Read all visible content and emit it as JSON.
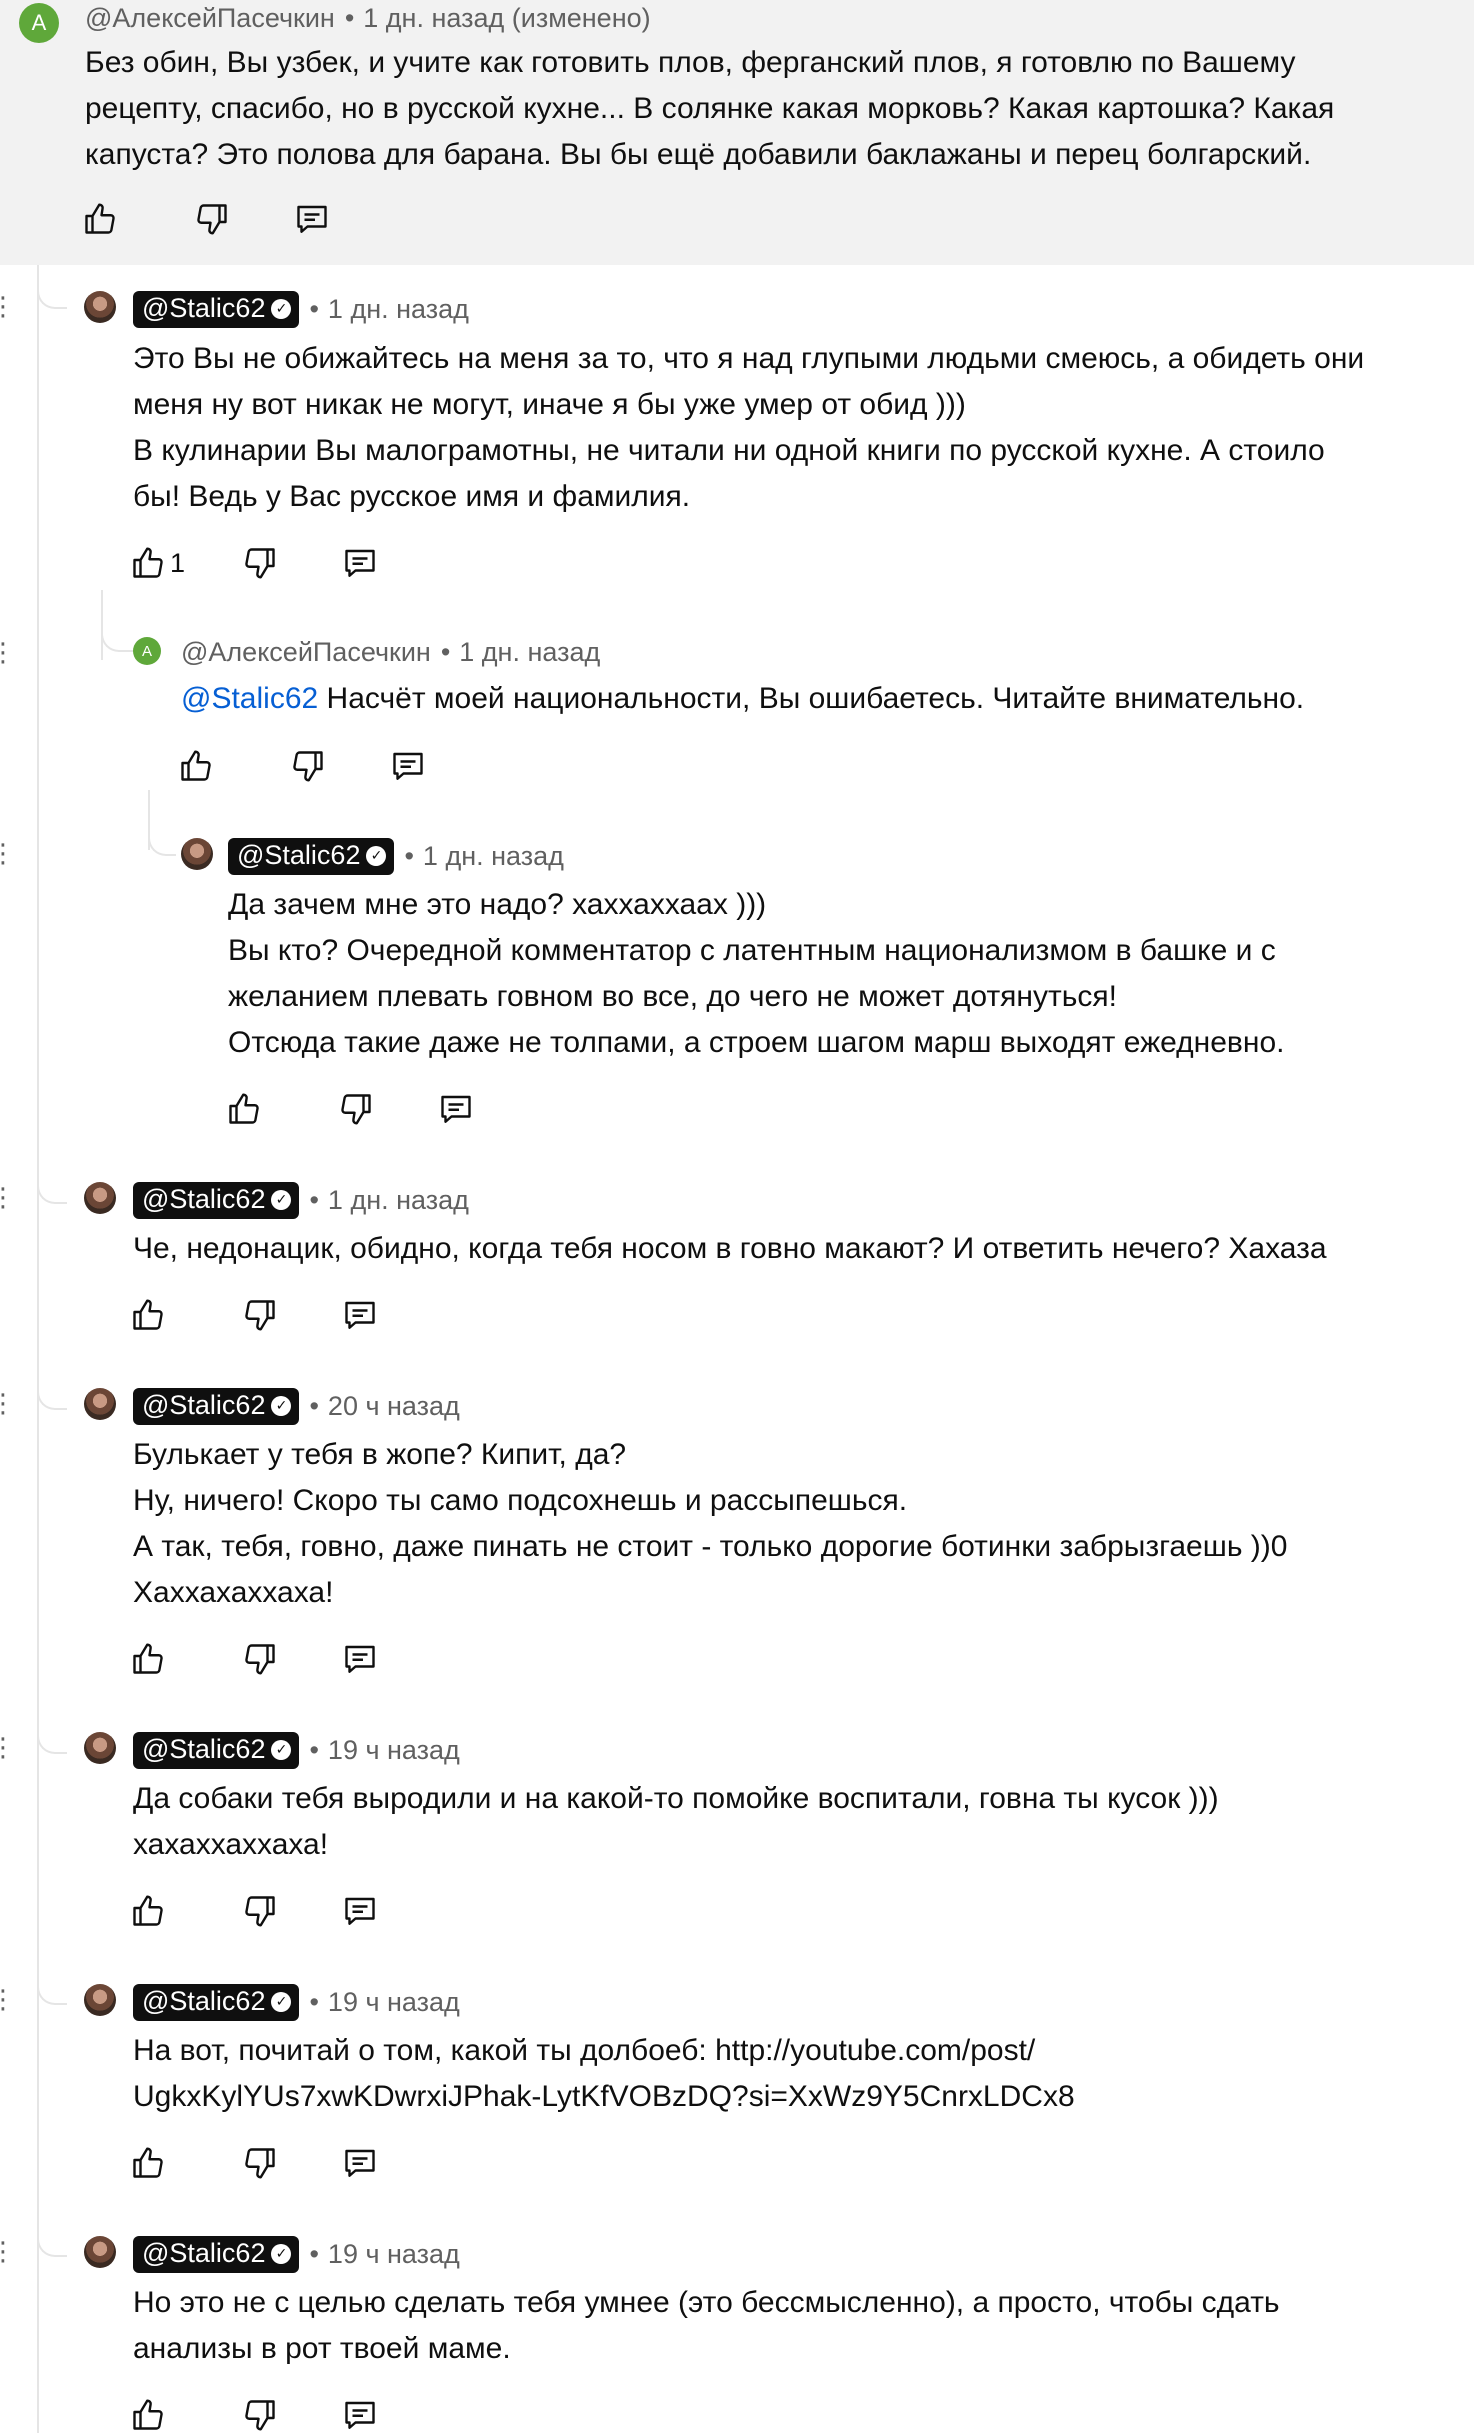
{
  "comments": [
    {
      "author": "@АлексейПасечкин",
      "avatar_letter": "А",
      "time": "1 дн. назад (изменено)",
      "lines": [
        "Без обин, Вы узбек, и учите как готовить плов, ферганский плов, я готовлю по Вашему",
        "рецепту, спасибо, но в русской кухне... В солянке  какая морковь? Какая картошка? Какая",
        "капуста? Это полова для барана. Вы бы ещё добавили баклажаны и перец болгарский."
      ],
      "likes": ""
    },
    {
      "author": "@Stalic62",
      "time": "1 дн. назад",
      "lines": [
        "Это Вы не обижайтесь на меня за то, что я над глупыми людьми смеюсь, а обидеть они",
        "меня ну вот никак не могут, иначе я бы уже умер от обид )))",
        "В кулинарии Вы малограмотны, не читали ни одной книги по русской кухне. А стоило",
        "бы! Ведь у Вас русское имя и фамилия."
      ],
      "likes": "1"
    },
    {
      "author": "@АлексейПасечкин",
      "avatar_letter": "А",
      "time": "1 дн. назад",
      "mention": "@Stalic62",
      "lines": [
        " Насчёт моей национальности, Вы ошибаетесь. Читайте внимательно."
      ],
      "likes": ""
    },
    {
      "author": "@Stalic62",
      "time": "1 дн. назад",
      "lines": [
        "Да зачем мне это надо? хаххаххаах )))",
        "Вы кто? Очередной комментатор с латентным национализмом в башке и с",
        "желанием плевать говном во все, до чего не может дотянуться!",
        "Отсюда такие даже не толпами, а строем шагом марш выходят ежедневно."
      ],
      "likes": ""
    },
    {
      "author": "@Stalic62",
      "time": "1 дн. назад",
      "lines": [
        "Че, недонацик, обидно, когда тебя носом в говно макают? И ответить нечего? Хахаза"
      ],
      "likes": ""
    },
    {
      "author": "@Stalic62",
      "time": "20 ч назад",
      "lines": [
        "Булькает  у тебя в жопе? Кипит, да?",
        "Ну, ничего! Скоро ты само подсохнешь и рассыпешься.",
        "А так, тебя, говно, даже пинать не стоит - только дорогие ботинки забрызгаешь ))0",
        "Хаххахаххаха!"
      ],
      "likes": ""
    },
    {
      "author": "@Stalic62",
      "time": "19 ч назад",
      "lines": [
        "Да собаки тебя выродили и на какой-то помойке воспитали, говна ты кусок )))",
        "хахаххаххаха!"
      ],
      "likes": ""
    },
    {
      "author": "@Stalic62",
      "time": "19 ч назад",
      "lines": [
        "На вот, почитай о том, какой ты долбоеб: http://youtube.com/post/",
        "UgkxKylYUs7xwKDwrxiJPhak-LytKfVOBzDQ?si=XxWz9Y5CnrxLDCx8"
      ],
      "likes": ""
    },
    {
      "author": "@Stalic62",
      "time": "19 ч назад",
      "lines": [
        "Но это не с целью сделать тебя умнее (это бессмысленно), а просто, чтобы сдать",
        "анализы в рот твоей маме."
      ],
      "likes": ""
    }
  ],
  "icons": {
    "like": "thumbs-up-icon",
    "dislike": "thumbs-down-icon",
    "reply": "reply-comment-icon",
    "verified": "verified-check-icon",
    "more": "more-vertical-icon"
  },
  "colors": {
    "highlight_bg": "#f2f2f2",
    "avatar_letter_bg": "#5fa83a",
    "mention": "#065fd4",
    "meta_text": "#606060",
    "badge_bg": "#0f0f0f"
  }
}
